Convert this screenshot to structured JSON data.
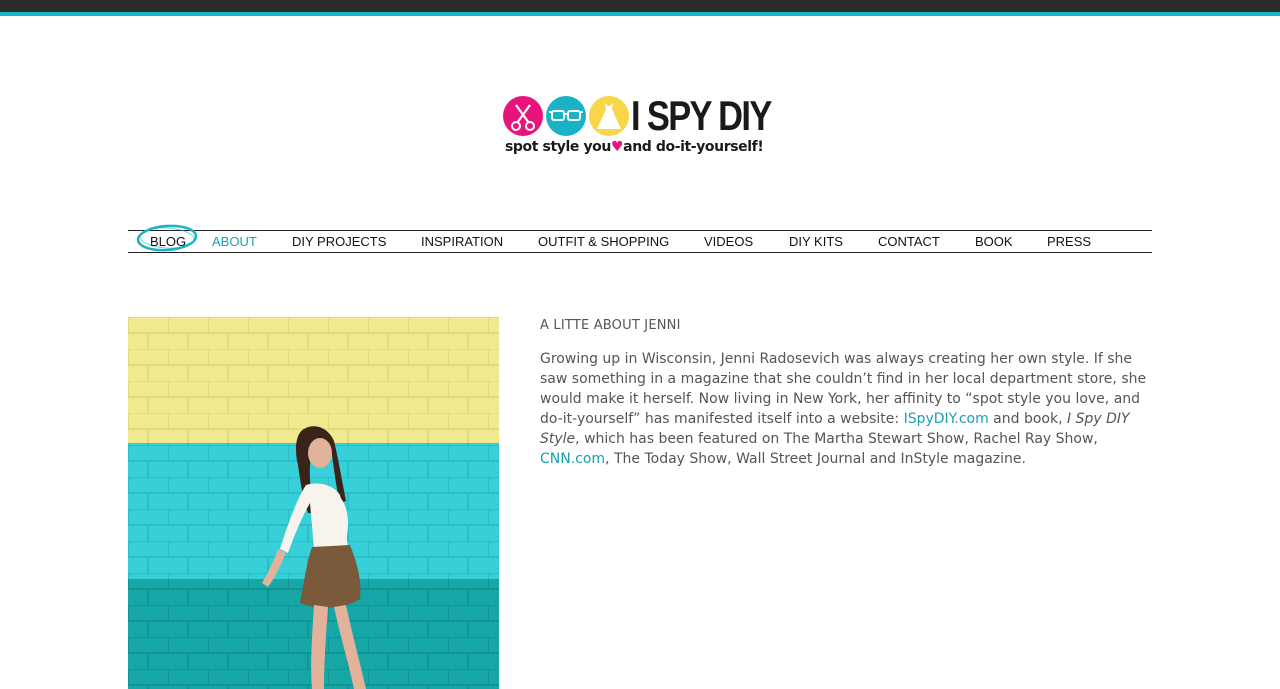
{
  "logo": {
    "wordmark": "I SPY DIY",
    "tagline_before": "spot style you",
    "tagline_heart": "♥",
    "tagline_after": "and do-it-yourself!"
  },
  "nav": {
    "items": [
      {
        "label": "BLOG"
      },
      {
        "label": "ABOUT"
      },
      {
        "label": "DIY PROJECTS"
      },
      {
        "label": "INSPIRATION"
      },
      {
        "label": "OUTFIT & SHOPPING"
      },
      {
        "label": "VIDEOS"
      },
      {
        "label": "DIY KITS"
      },
      {
        "label": "CONTACT"
      },
      {
        "label": "BOOK"
      },
      {
        "label": "PRESS"
      }
    ],
    "active": "ABOUT"
  },
  "about": {
    "title": "A LITTE ABOUT JENNI",
    "p1": "Growing up in Wisconsin, Jenni Radosevich was always creating her own style. If she saw something in a magazine that she couldn’t find in her local department store, she would make it herself. Now living in New York, her affinity to “spot style you love, and do-it-yourself” has manifested itself into a website: ",
    "link1": "ISpyDIY.com",
    "p2": " and book, ",
    "book_title": "I Spy DIY Style",
    "p3": ", which has been featured on The Martha Stewart Show, Rachel Ray Show, ",
    "link2": "CNN.com",
    "p4": ", The Today Show, Wall Street Journal and InStyle magazine."
  },
  "colors": {
    "accent": "#1ab3c6",
    "pink": "#e8147c",
    "yellow": "#f7d64a",
    "wall_yellow": "#f1e98e",
    "wall_cyan": "#37cfd8",
    "wall_teal": "#17a6a6"
  }
}
